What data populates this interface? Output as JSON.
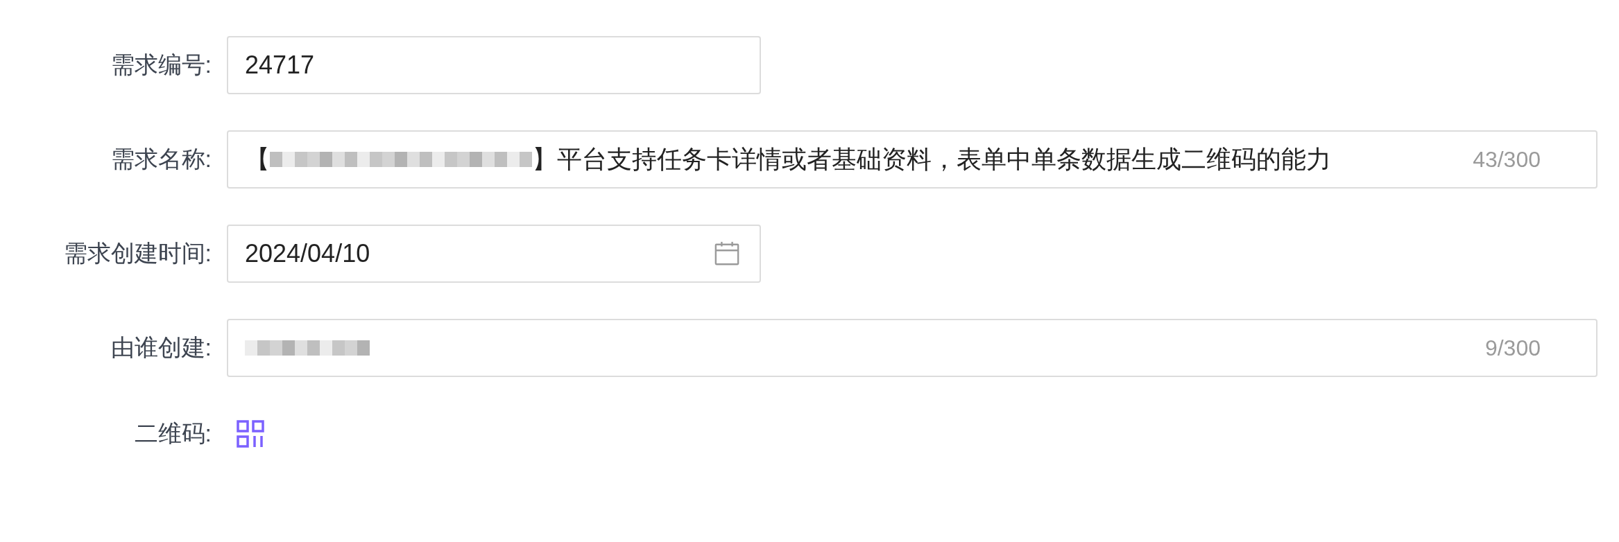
{
  "form": {
    "rows": [
      {
        "kind": "text",
        "label": "需求编号:",
        "segments": [
          {
            "kind": "text",
            "text": "24717"
          }
        ]
      },
      {
        "kind": "counted",
        "label": "需求名称:",
        "segments": [
          {
            "kind": "text",
            "text": "【"
          },
          {
            "kind": "blurred"
          },
          {
            "kind": "text",
            "text": "】平台支持任务卡详情或者基础资料，表单中单条数据生成二维码的能力"
          }
        ],
        "counter": "43/300"
      },
      {
        "kind": "date",
        "label": "需求创建时间:",
        "segments": [
          {
            "kind": "text",
            "text": "2024/04/10"
          }
        ]
      },
      {
        "kind": "counted",
        "label": "由谁创建:",
        "segments": [
          {
            "kind": "blurred"
          }
        ],
        "counter": "9/300"
      },
      {
        "kind": "qr",
        "label": "二维码:"
      }
    ]
  }
}
